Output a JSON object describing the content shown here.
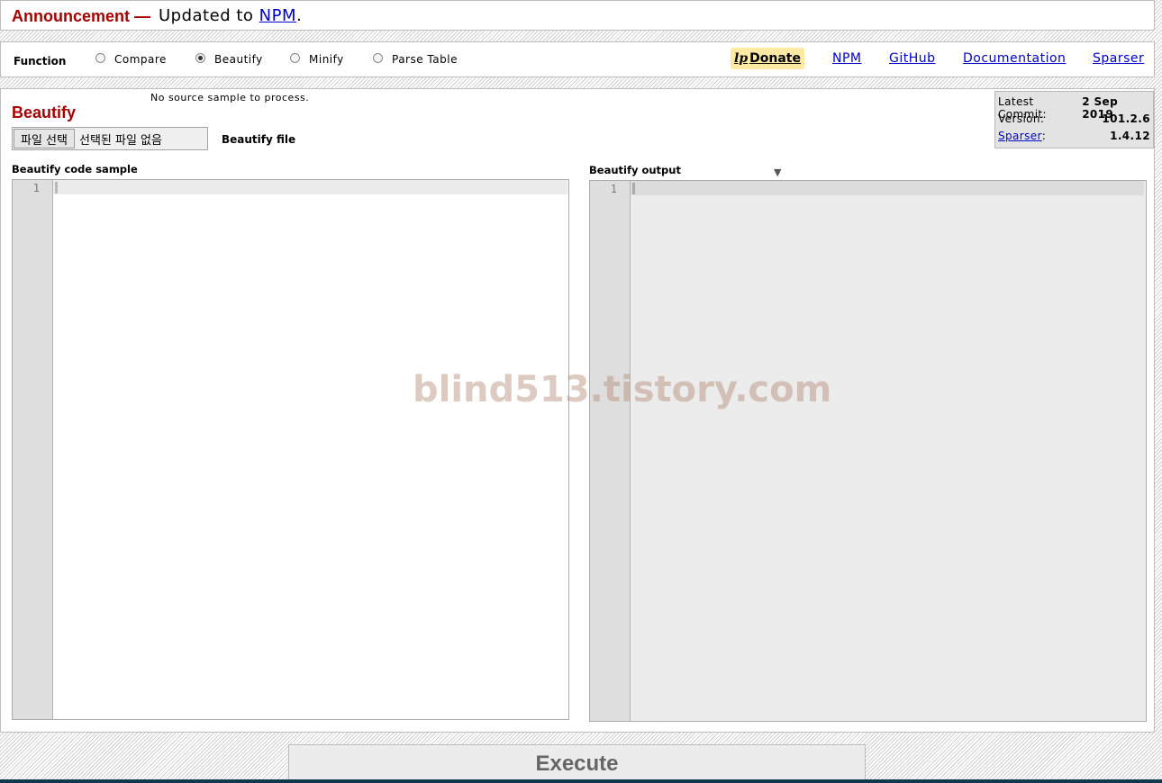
{
  "announcement": {
    "label": "Announcement —",
    "text": "Updated to",
    "link": "NPM",
    "trail": "."
  },
  "function_bar": {
    "label": "Function",
    "options": [
      {
        "label": "Compare",
        "selected": false
      },
      {
        "label": "Beautify",
        "selected": true
      },
      {
        "label": "Minify",
        "selected": false
      },
      {
        "label": "Parse Table",
        "selected": false
      }
    ],
    "donate": {
      "icon": "lp",
      "label": "Donate"
    },
    "links": [
      "NPM",
      "GitHub",
      "Documentation",
      "Sparser"
    ]
  },
  "main": {
    "no_source": "No source sample to process.",
    "title": "Beautify",
    "file_button": "파일 선택",
    "file_status": "선택된 파일 없음",
    "file_label": "Beautify file",
    "info": {
      "commit_label": "Latest Commit:",
      "commit_value": "2 Sep 2019",
      "version_label": "Version:",
      "version_value": "101.2.6",
      "sparser_label": "Sparser",
      "sparser_colon": ":",
      "sparser_value": "1.4.12"
    },
    "input_label": "Beautify code sample",
    "output_label": "Beautify output",
    "output_arrow": "▼",
    "input_line": "1",
    "output_line": "1"
  },
  "watermark": "blind513.tistory.com",
  "execute_label": "Execute",
  "colors": {
    "accent_red": "#a80000",
    "link_blue": "#0000cc",
    "donate_bg": "#fde9a1",
    "footer": "#0e3a4a"
  }
}
